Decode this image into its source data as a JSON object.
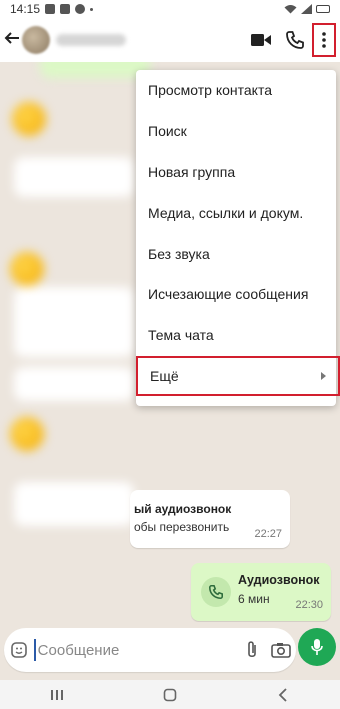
{
  "status_bar": {
    "time": "14:15"
  },
  "app_bar": {
    "contact_name": ""
  },
  "menu": {
    "items": [
      {
        "label": "Просмотр контакта"
      },
      {
        "label": "Поиск"
      },
      {
        "label": "Новая группа"
      },
      {
        "label": "Медиа, ссылки и докум."
      },
      {
        "label": "Без звука"
      },
      {
        "label": "Исчезающие сообщения"
      },
      {
        "label": "Тема чата"
      },
      {
        "label": "Ещё"
      }
    ]
  },
  "messages": {
    "incoming_call": {
      "line1": "ый аудиозвонок",
      "line2": "обы перезвонить",
      "time": "22:27"
    },
    "outgoing_call": {
      "title": "Аудиозвонок",
      "duration": "6 мин",
      "time": "22:30"
    }
  },
  "composer": {
    "placeholder": "Сообщение"
  },
  "colors": {
    "accent": "#1fa855",
    "highlight": "#d21f2e",
    "outgoing_bubble": "#dcf8c6",
    "chat_bg": "#ece5dd"
  },
  "icons": [
    "back-arrow-icon",
    "video-call-icon",
    "phone-icon",
    "more-vert-icon",
    "emoji-icon",
    "attach-icon",
    "camera-icon",
    "mic-icon",
    "call-icon",
    "chevron-right-icon"
  ]
}
